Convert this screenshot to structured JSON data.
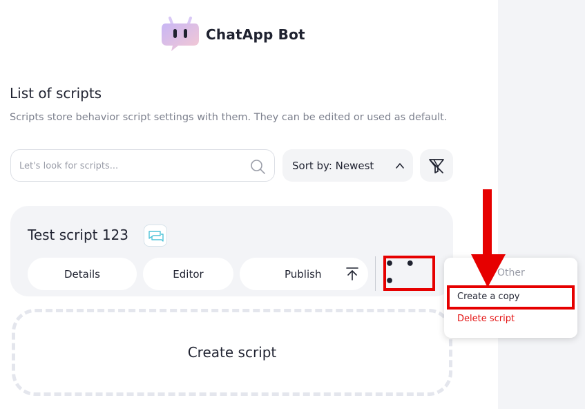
{
  "brand": {
    "name": "ChatApp Bot",
    "accent": "#b79cf0"
  },
  "page": {
    "title": "List of scripts",
    "description": "Scripts store behavior script settings with them. They can be edited or used as default."
  },
  "search": {
    "placeholder": "Let's look for scripts...",
    "value": ""
  },
  "sort": {
    "label": "Sort by: Newest"
  },
  "script_card": {
    "name": "Test script 123",
    "buttons": {
      "details": "Details",
      "editor": "Editor",
      "publish": "Publish",
      "more": "• • •"
    }
  },
  "create": {
    "label": "Create script"
  },
  "dropdown": {
    "heading": "Other",
    "items": [
      {
        "label": "Create a copy",
        "color": "#1f2230"
      },
      {
        "label": "Delete script",
        "color": "#e30f0f"
      }
    ]
  },
  "annotation": {
    "highlight_color": "#e60000"
  }
}
